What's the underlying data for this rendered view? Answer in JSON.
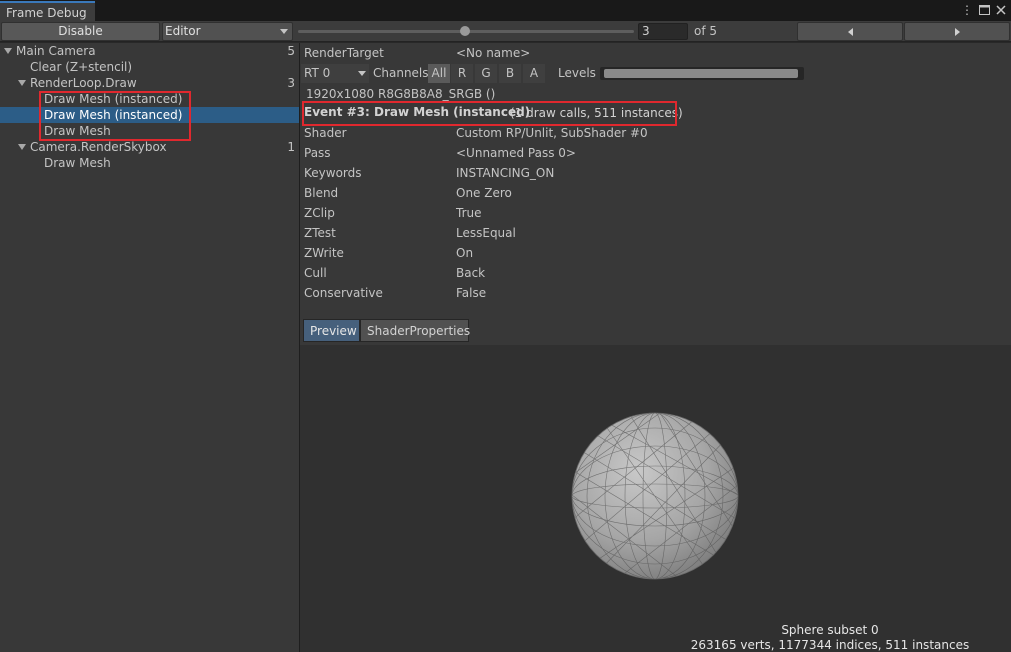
{
  "window": {
    "tab_title": "Frame Debug",
    "icons": [
      "kebab-menu-icon",
      "maximize-icon",
      "close-icon"
    ]
  },
  "toolbar": {
    "disable_label": "Disable",
    "target_dropdown": "Editor",
    "event_index": "3",
    "event_total_label": "of 5",
    "slider_fraction": 0.5
  },
  "tree": {
    "items": [
      {
        "label": "Main Camera",
        "count": "5",
        "depth": 0,
        "foldout": true
      },
      {
        "label": "Clear (Z+stencil)",
        "count": "",
        "depth": 1,
        "foldout": false
      },
      {
        "label": "RenderLoop.Draw",
        "count": "3",
        "depth": 1,
        "foldout": true
      },
      {
        "label": "Draw Mesh (instanced)",
        "count": "",
        "depth": 2,
        "foldout": false
      },
      {
        "label": "Draw Mesh (instanced)",
        "count": "",
        "depth": 2,
        "foldout": false,
        "selected": true
      },
      {
        "label": "Draw Mesh",
        "count": "",
        "depth": 2,
        "foldout": false
      },
      {
        "label": "Camera.RenderSkybox",
        "count": "1",
        "depth": 1,
        "foldout": true
      },
      {
        "label": "Draw Mesh",
        "count": "",
        "depth": 2,
        "foldout": false
      }
    ]
  },
  "render_target": {
    "label": "RenderTarget",
    "value": "<No name>",
    "rt_dropdown": "RT 0",
    "channels_label": "Channels",
    "channels": [
      "All",
      "R",
      "G",
      "B",
      "A"
    ],
    "active_channel": "All",
    "levels_label": "Levels",
    "format": "1920x1080 R8G8B8A8_SRGB ()"
  },
  "event": {
    "title": "Event #3: Draw Mesh (instanced)",
    "info": "(1 draw calls, 511 instances)"
  },
  "properties": [
    {
      "name": "Shader",
      "value": "Custom RP/Unlit, SubShader #0"
    },
    {
      "name": "Pass",
      "value": "<Unnamed Pass 0>"
    },
    {
      "name": "Keywords",
      "value": "INSTANCING_ON"
    },
    {
      "name": "Blend",
      "value": "One Zero"
    },
    {
      "name": "ZClip",
      "value": "True"
    },
    {
      "name": "ZTest",
      "value": "LessEqual"
    },
    {
      "name": "ZWrite",
      "value": "On"
    },
    {
      "name": "Cull",
      "value": "Back"
    },
    {
      "name": "Conservative",
      "value": "False"
    }
  ],
  "preview_tabs": [
    "Preview",
    "ShaderProperties"
  ],
  "preview": {
    "subset": "Sphere subset 0",
    "stats": "263165 verts, 1177344 indices, 511 instances"
  },
  "colors": {
    "highlight_red": "#e0282e",
    "selection_blue": "#2c5d87",
    "tab_accent": "#3a79bb"
  }
}
